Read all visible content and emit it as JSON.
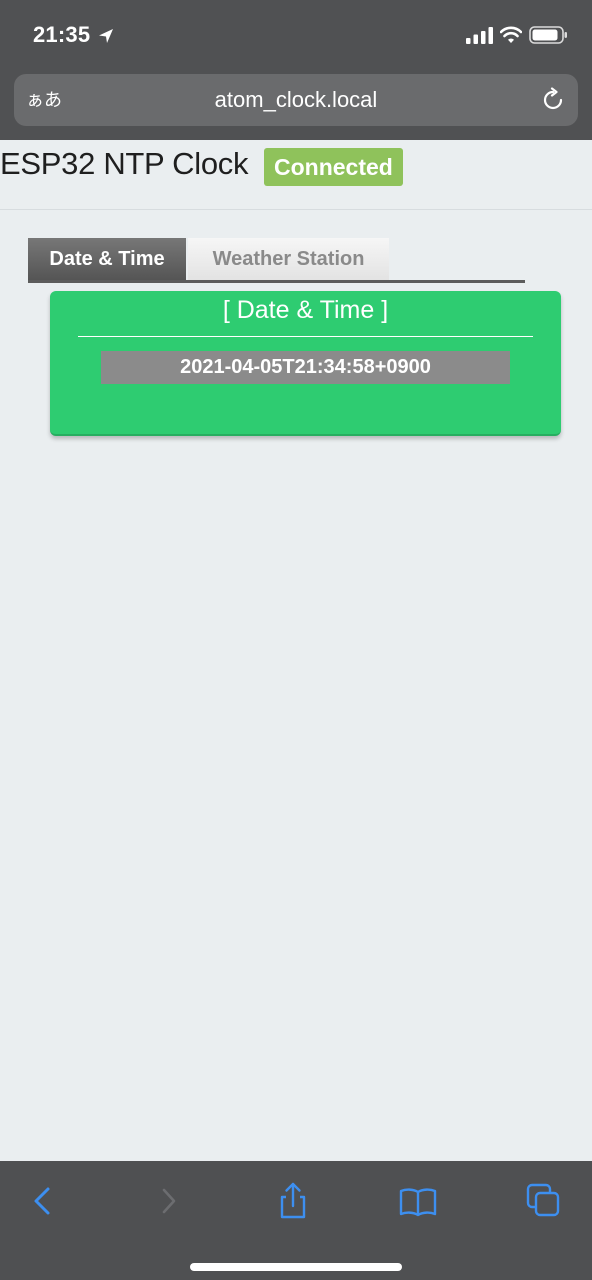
{
  "status_bar": {
    "time": "21:35"
  },
  "address_bar": {
    "text_size_label": "ぁあ",
    "url": "atom_clock.local"
  },
  "header": {
    "title": "ESP32 NTP Clock",
    "status": "Connected"
  },
  "tabs": [
    {
      "label": "Date & Time",
      "active": true
    },
    {
      "label": "Weather Station",
      "active": false
    }
  ],
  "panel": {
    "title": "[ Date & Time ]",
    "datetime": "2021-04-05T21:34:58+0900"
  },
  "colors": {
    "panel": "#2ecc71",
    "badge": "#8fc25b",
    "toolbar_accent": "#3d8ff0"
  },
  "toolbar": {
    "icons": [
      "back-icon",
      "forward-icon",
      "share-icon",
      "bookmarks-icon",
      "tabs-icon"
    ]
  }
}
